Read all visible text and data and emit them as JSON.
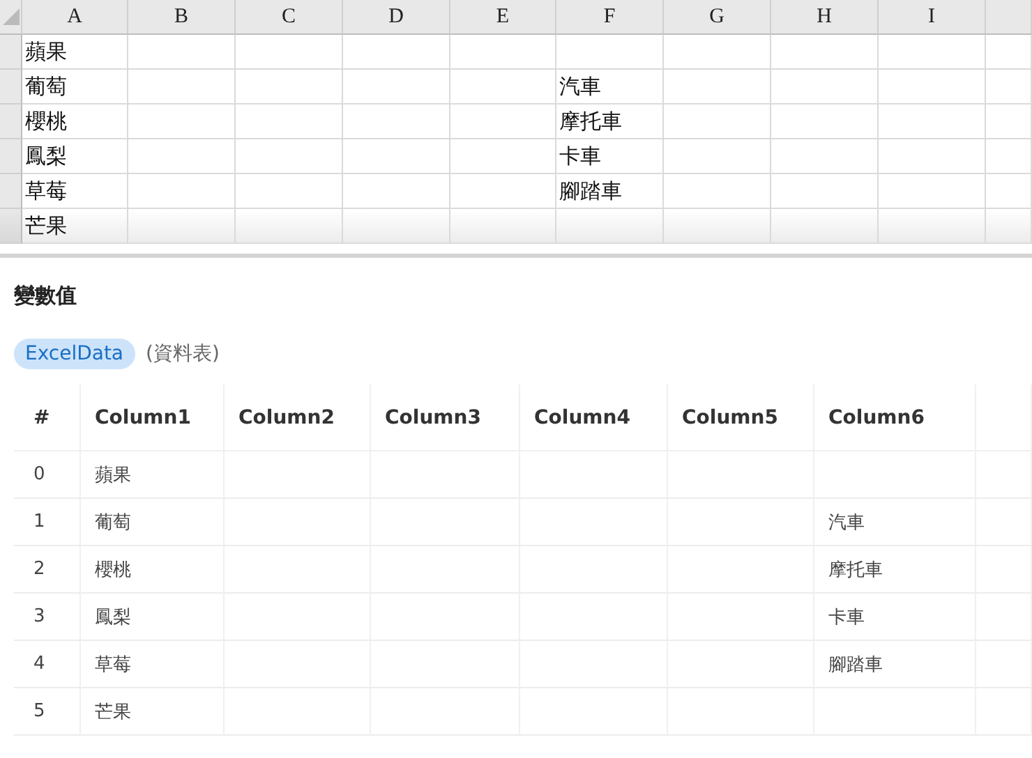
{
  "spreadsheet": {
    "columns": [
      "A",
      "B",
      "C",
      "D",
      "E",
      "F",
      "G",
      "H",
      "I"
    ],
    "rows": [
      [
        "蘋果",
        null,
        null,
        null,
        null,
        null,
        null,
        null,
        null
      ],
      [
        "葡萄",
        null,
        null,
        null,
        null,
        "汽車",
        null,
        null,
        null
      ],
      [
        "櫻桃",
        null,
        null,
        null,
        null,
        "摩托車",
        null,
        null,
        null
      ],
      [
        "鳳梨",
        null,
        null,
        null,
        null,
        "卡車",
        null,
        null,
        null
      ],
      [
        "草莓",
        null,
        null,
        null,
        null,
        "腳踏車",
        null,
        null,
        null
      ],
      [
        "芒果",
        null,
        null,
        null,
        null,
        null,
        null,
        null,
        null
      ]
    ]
  },
  "variables": {
    "heading": "變數值",
    "variable": {
      "name": "ExcelData",
      "type": "(資料表)"
    },
    "table": {
      "columns": [
        "#",
        "Column1",
        "Column2",
        "Column3",
        "Column4",
        "Column5",
        "Column6"
      ],
      "rows": [
        [
          "0",
          "蘋果",
          null,
          null,
          null,
          null,
          null
        ],
        [
          "1",
          "葡萄",
          null,
          null,
          null,
          null,
          "汽車"
        ],
        [
          "2",
          "櫻桃",
          null,
          null,
          null,
          null,
          "摩托車"
        ],
        [
          "3",
          "鳳梨",
          null,
          null,
          null,
          null,
          "卡車"
        ],
        [
          "4",
          "草莓",
          null,
          null,
          null,
          null,
          "腳踏車"
        ],
        [
          "5",
          "芒果",
          null,
          null,
          null,
          null,
          null
        ]
      ]
    }
  }
}
